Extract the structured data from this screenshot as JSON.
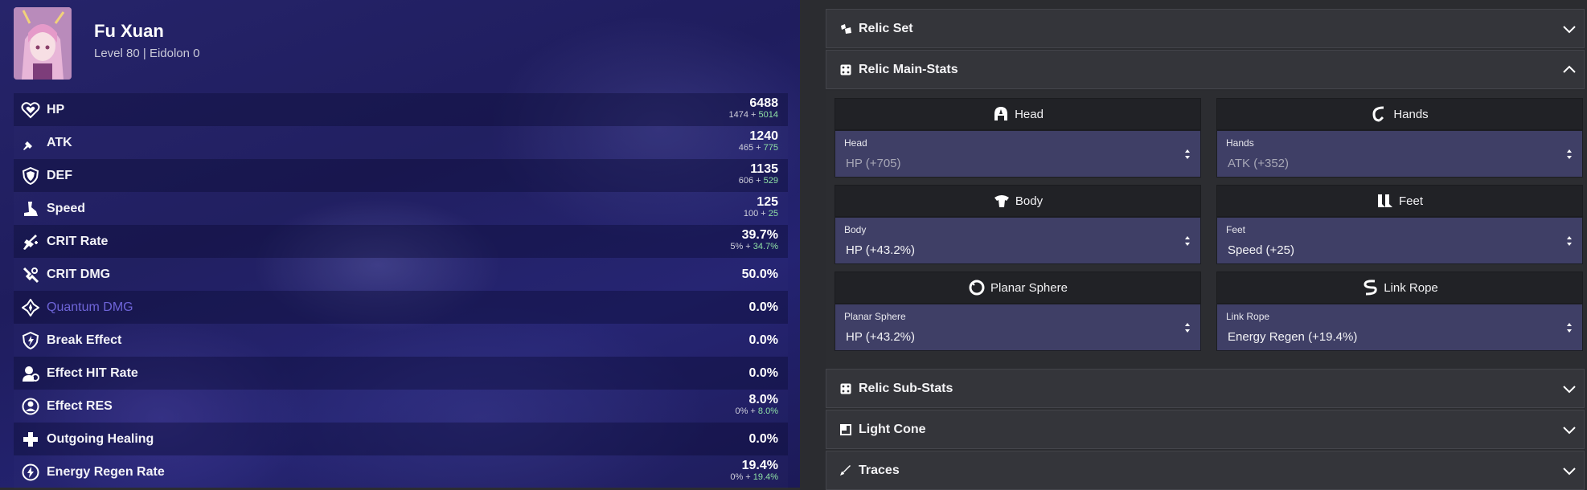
{
  "character": {
    "name": "Fu Xuan",
    "subtitle": "Level 80 | Eidolon 0"
  },
  "stats": [
    {
      "icon": "hp-icon",
      "label": "HP",
      "total": "6488",
      "base": "1474",
      "sep": " + ",
      "bonus": "5014"
    },
    {
      "icon": "atk-icon",
      "label": "ATK",
      "total": "1240",
      "base": "465",
      "sep": " + ",
      "bonus": "775"
    },
    {
      "icon": "def-icon",
      "label": "DEF",
      "total": "1135",
      "base": "606",
      "sep": " + ",
      "bonus": "529"
    },
    {
      "icon": "speed-icon",
      "label": "Speed",
      "total": "125",
      "base": "100",
      "sep": " + ",
      "bonus": "25"
    },
    {
      "icon": "crit-rate-icon",
      "label": "CRIT Rate",
      "total": "39.7%",
      "base": "5%",
      "sep": " + ",
      "bonus": "34.7%"
    },
    {
      "icon": "crit-dmg-icon",
      "label": "CRIT DMG",
      "total": "50.0%"
    },
    {
      "icon": "quantum-icon",
      "label": "Quantum DMG",
      "total": "0.0%"
    },
    {
      "icon": "break-effect-icon",
      "label": "Break Effect",
      "total": "0.0%"
    },
    {
      "icon": "effect-hit-icon",
      "label": "Effect HIT Rate",
      "total": "0.0%"
    },
    {
      "icon": "effect-res-icon",
      "label": "Effect RES",
      "total": "8.0%",
      "base": "0%",
      "sep": " + ",
      "bonus": "8.0%"
    },
    {
      "icon": "healing-icon",
      "label": "Outgoing Healing",
      "total": "0.0%"
    },
    {
      "icon": "energy-regen-icon",
      "label": "Energy Regen Rate",
      "total": "19.4%",
      "base": "0%",
      "sep": " + ",
      "bonus": "19.4%"
    }
  ],
  "sections": {
    "relic_set": {
      "title": "Relic Set",
      "icon": "relic-set-icon",
      "chevron": "chevron-down"
    },
    "relic_main": {
      "title": "Relic Main-Stats",
      "icon": "dice-icon",
      "chevron": "chevron-up"
    },
    "relic_sub": {
      "title": "Relic Sub-Stats",
      "icon": "dice-icon",
      "chevron": "chevron-down"
    },
    "light_cone": {
      "title": "Light Cone",
      "icon": "light-cone-icon",
      "chevron": "chevron-down"
    },
    "traces": {
      "title": "Traces",
      "icon": "traces-icon",
      "chevron": "chevron-down"
    }
  },
  "slots": [
    {
      "icon": "head-icon",
      "title": "Head",
      "label": "Head",
      "value": "HP (+705)"
    },
    {
      "icon": "hands-icon",
      "title": "Hands",
      "label": "Hands",
      "value": "ATK (+352)"
    },
    {
      "icon": "body-icon",
      "title": "Body",
      "label": "Body",
      "value": "HP (+43.2%)"
    },
    {
      "icon": "feet-icon",
      "title": "Feet",
      "label": "Feet",
      "value": "Speed (+25)"
    },
    {
      "icon": "planar-sphere-icon",
      "title": "Planar Sphere",
      "label": "Planar Sphere",
      "value": "HP (+43.2%)"
    },
    {
      "icon": "link-rope-icon",
      "title": "Link Rope",
      "label": "Link Rope",
      "value": "Energy Regen (+19.4%)"
    }
  ],
  "colors": {
    "accent_quantum": "#6e64d8",
    "bonus_green": "#8fe0a5",
    "select_bg": "#3f3f66"
  }
}
